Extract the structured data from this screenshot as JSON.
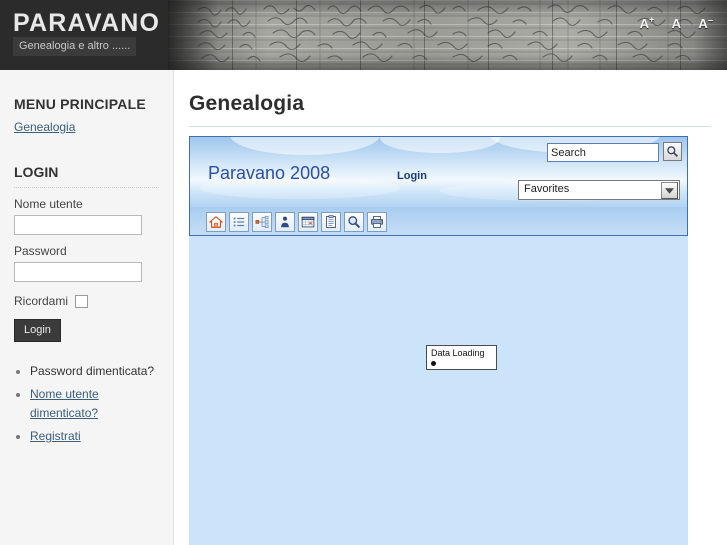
{
  "banner": {
    "site_title": "PARAVANO",
    "site_subtitle": "Genealogia e altro ......",
    "font_sizer": {
      "increase": "A",
      "increase_sup": "+",
      "normal": "A",
      "decrease": "A",
      "decrease_sup": "−"
    },
    "background_image": "handwritten-census-ledger-scan"
  },
  "sidebar": {
    "menu_title": "MENU PRINCIPALE",
    "menu_items": [
      {
        "label": "Genealogia"
      }
    ],
    "login_title": "LOGIN",
    "username_label": "Nome utente",
    "username_value": "",
    "username_placeholder": "",
    "password_label": "Password",
    "password_value": "",
    "password_placeholder": "",
    "remember_label": "Ricordami",
    "remember_checked": false,
    "login_button": "Login",
    "help_links": [
      {
        "label": "Password dimenticata?",
        "linked": false
      },
      {
        "label": "Nome utente dimenticato?",
        "linked": true
      },
      {
        "label": "Registrati",
        "linked": true
      }
    ]
  },
  "main": {
    "page_title": "Genealogia",
    "iframe": {
      "brand": "Paravano 2008",
      "login_link": "Login",
      "search_value": "Search",
      "search_placeholder": "Search",
      "search_button_icon": "magnifier-icon",
      "favorites_value": "Favorites",
      "favorites_options": [
        "Favorites"
      ],
      "toolbar": [
        {
          "icon": "home-icon",
          "label": "Home"
        },
        {
          "icon": "list-icon",
          "label": "List"
        },
        {
          "icon": "tree-chart-icon",
          "label": "Tree"
        },
        {
          "icon": "person-icon",
          "label": "Individual"
        },
        {
          "icon": "calendar-icon",
          "label": "Calendar"
        },
        {
          "icon": "document-icon",
          "label": "Report"
        },
        {
          "icon": "search-icon",
          "label": "Search"
        },
        {
          "icon": "printer-icon",
          "label": "Print"
        }
      ],
      "status_message": "Data Loading"
    }
  },
  "colors": {
    "banner_bg": "#2b2b2b",
    "sidebar_bg": "#f5f5f5",
    "link": "#3b5e7d",
    "iframe_body": "#cbe4fa",
    "iframe_border": "#3f6fae",
    "brand_blue": "#2b4ea8",
    "heading_rule": "#cfe0ee"
  }
}
